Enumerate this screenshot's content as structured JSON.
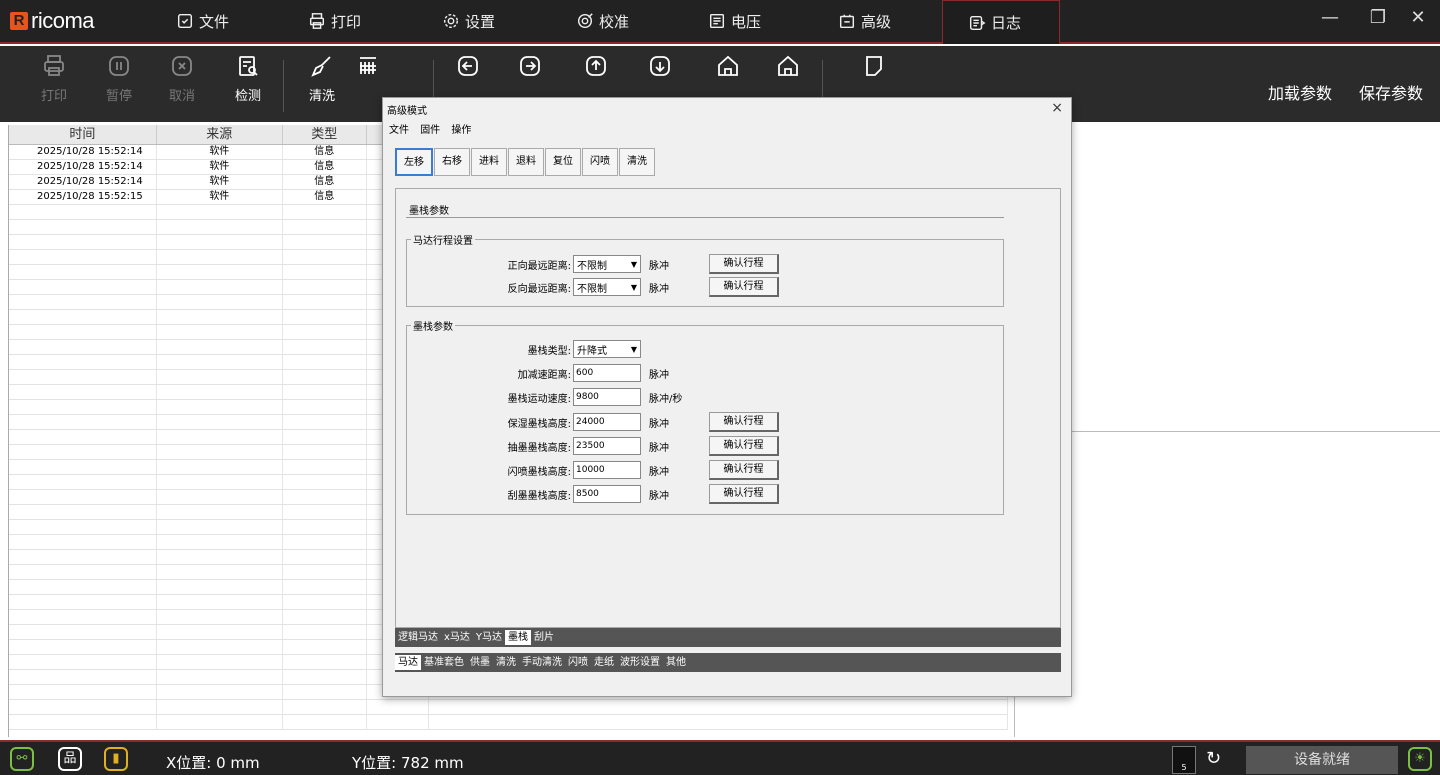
{
  "app": {
    "logo_mark": "R",
    "logo_text": "ricoma"
  },
  "menu": [
    {
      "label": "文件",
      "icon": "file-check-icon"
    },
    {
      "label": "打印",
      "icon": "printer-icon"
    },
    {
      "label": "设置",
      "icon": "gear-icon"
    },
    {
      "label": "校准",
      "icon": "target-icon"
    },
    {
      "label": "电压",
      "icon": "voltage-icon"
    },
    {
      "label": "高级",
      "icon": "advanced-icon"
    },
    {
      "label": "日志",
      "icon": "log-icon",
      "active": true
    }
  ],
  "window_controls": {
    "minimize": "—",
    "restore": "❐",
    "close": "✕"
  },
  "toolbar": {
    "print": "打印",
    "pause": "暂停",
    "cancel": "取消",
    "detect": "检测",
    "clean": "清洗",
    "load_params": "加载参数",
    "save_params": "保存参数"
  },
  "log": {
    "headers": [
      "时间",
      "来源",
      "类型"
    ],
    "rows": [
      {
        "time": "2025/10/28 15:52:14",
        "source": "软件",
        "type": "信息"
      },
      {
        "time": "2025/10/28 15:52:14",
        "source": "软件",
        "type": "信息"
      },
      {
        "time": "2025/10/28 15:52:14",
        "source": "软件",
        "type": "信息"
      },
      {
        "time": "2025/10/28 15:52:15",
        "source": "软件",
        "type": "信息"
      }
    ]
  },
  "status": {
    "x_pos": "X位置: 0 mm",
    "y_pos": "Y位置: 782 mm",
    "ready": "设备就绪",
    "battery_num": "5"
  },
  "dialog": {
    "title": "高级模式",
    "close": "×",
    "menu": [
      "文件",
      "固件",
      "操作"
    ],
    "buttons": [
      "左移",
      "右移",
      "进料",
      "退料",
      "复位",
      "闪喷",
      "清洗"
    ],
    "section_title": "墨栈参数",
    "motor_group": {
      "title": "马达行程设置",
      "rows": [
        {
          "label": "正向最远距离:",
          "value": "不限制",
          "unit": "脉冲",
          "btn": "确认行程"
        },
        {
          "label": "反向最远距离:",
          "value": "不限制",
          "unit": "脉冲",
          "btn": "确认行程"
        }
      ]
    },
    "stack_group": {
      "title": "墨栈参数",
      "type_label": "墨栈类型:",
      "type_value": "升降式",
      "rows": [
        {
          "label": "加减速距离:",
          "value": "600",
          "unit": "脉冲",
          "btn": ""
        },
        {
          "label": "墨栈运动速度:",
          "value": "9800",
          "unit": "脉冲/秒",
          "btn": ""
        },
        {
          "label": "保湿墨栈高度:",
          "value": "24000",
          "unit": "脉冲",
          "btn": "确认行程"
        },
        {
          "label": "抽墨墨栈高度:",
          "value": "23500",
          "unit": "脉冲",
          "btn": "确认行程"
        },
        {
          "label": "闪喷墨栈高度:",
          "value": "10000",
          "unit": "脉冲",
          "btn": "确认行程"
        },
        {
          "label": "刮墨墨栈高度:",
          "value": "8500",
          "unit": "脉冲",
          "btn": "确认行程"
        }
      ]
    },
    "inner_tabs": [
      "逻辑马达",
      "x马达",
      "Y马达",
      "墨栈",
      "刮片"
    ],
    "inner_active": 3,
    "outer_tabs": [
      "马达",
      "基准套色",
      "供墨",
      "清洗",
      "手动清洗",
      "闪喷",
      "走纸",
      "波形设置",
      "其他"
    ],
    "outer_active": 0
  }
}
